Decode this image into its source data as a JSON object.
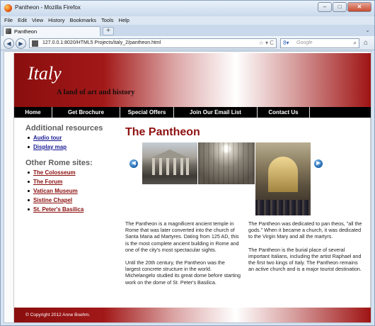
{
  "browser": {
    "window_title": "Pantheon - Mozilla Firefox",
    "menu": [
      "File",
      "Edit",
      "View",
      "History",
      "Bookmarks",
      "Tools",
      "Help"
    ],
    "tab_label": "Pantheon",
    "new_tab_label": "+",
    "url": "127.0.0.1:8020/HTML5 Projects/italy_2/pantheon.html",
    "search_placeholder": "Google"
  },
  "site": {
    "logo": "Italy",
    "tagline": "A land of art and history",
    "nav": [
      "Home",
      "Get Brochure",
      "Special Offers",
      "Join Our Email List",
      "Contact Us"
    ],
    "sidebar": {
      "resources_heading": "Additional resources",
      "resources": [
        "Audio tour",
        "Display map"
      ],
      "sites_heading": "Other Rome sites:",
      "sites": [
        "The Colosseum",
        "The Forum",
        "Vatican Museum",
        "Sistine Chapel",
        "St. Peter's Basilica"
      ]
    },
    "main": {
      "title": "The Pantheon",
      "paragraphs_left": [
        "The Pantheon is a magnificent ancient temple in Rome that was later converted into the church of Santa Maria ad Martyres. Dating from 125 AD, this is the most complete ancient building in Rome and one of the city's most spectacular sights.",
        "Until the 20th century, the Pantheon was the largest concrete structure in the world. Michelangelo studied its great dome before starting work on the dome of St. Peter's Basilica."
      ],
      "paragraphs_right": [
        "The Pantheon was dedicated to pan theos, \"all the gods.\" When it became a church, it was dedicated to the Virgin Mary and all the martyrs.",
        "The Pantheon is the burial place of several important Italians, including the artist Raphael and the first two kings of Italy. The Pantheon remains an active church and is a major tourist destination."
      ]
    },
    "footer": "© Copyright 2012 Anne Boehm."
  },
  "colors": {
    "brand_red": "#8f1010",
    "nav_bg": "#000000",
    "link_blue": "#1b1b96"
  }
}
